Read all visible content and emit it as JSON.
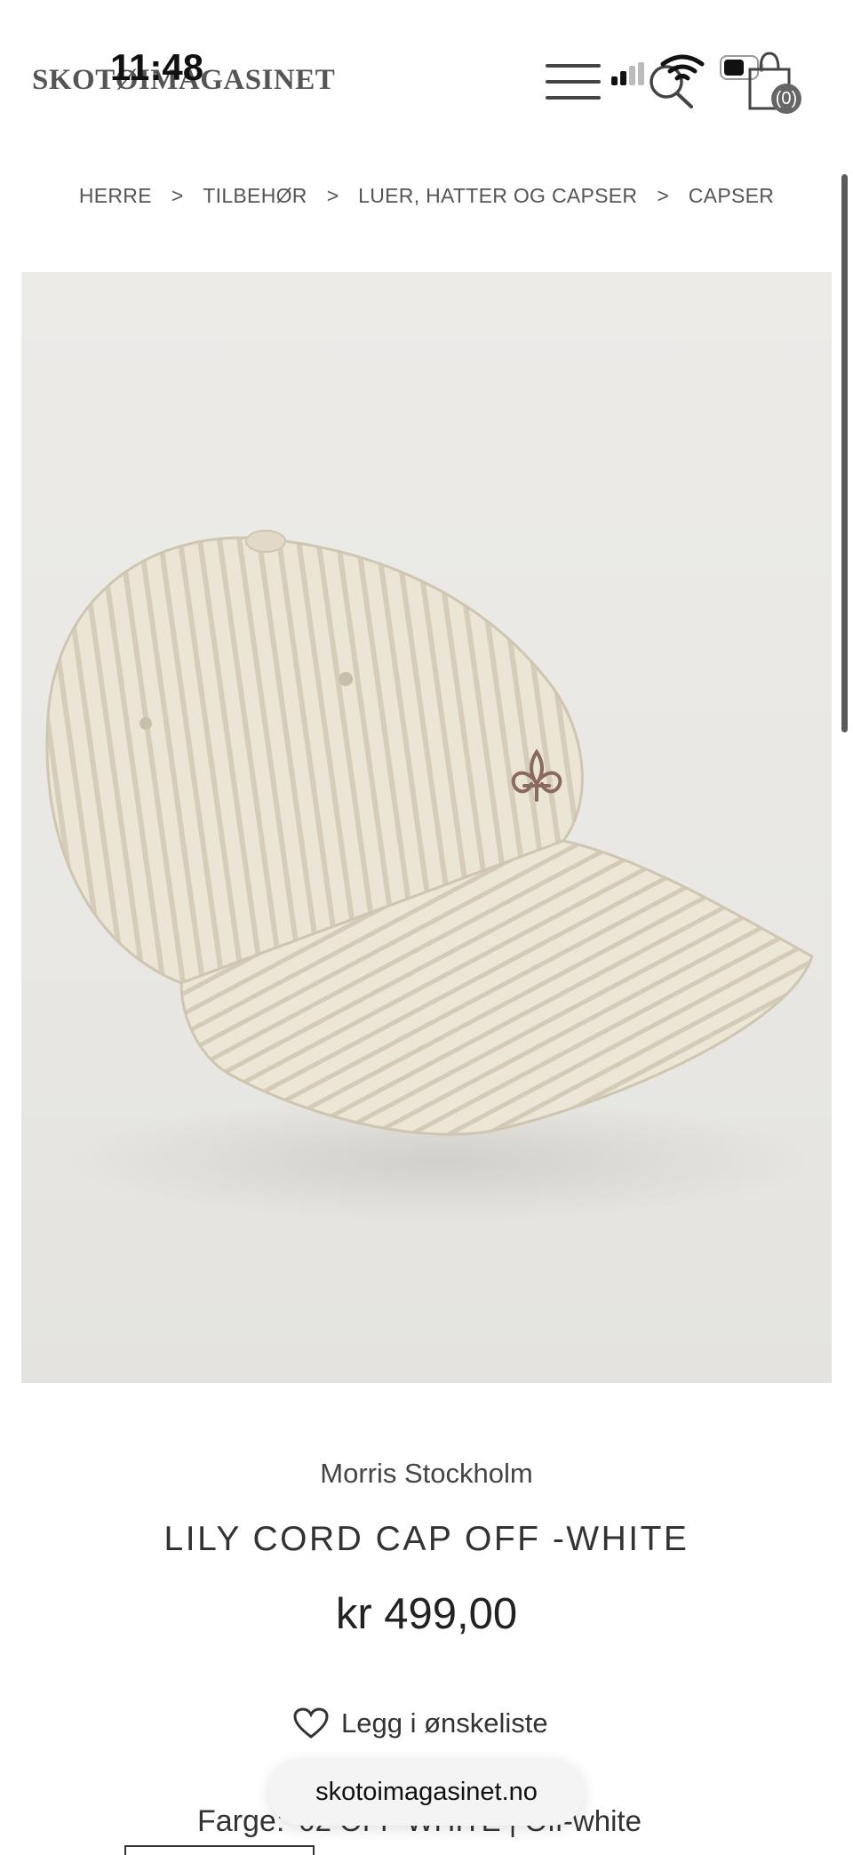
{
  "status_bar": {
    "time": "11:48"
  },
  "header": {
    "logo": "SKOTØIMAGASINET",
    "cart_count": "(0)"
  },
  "breadcrumb": {
    "items": [
      "HERRE",
      "TILBEHØR",
      "LUER, HATTER OG CAPSER",
      "CAPSER"
    ],
    "separator": ">"
  },
  "product": {
    "brand": "Morris Stockholm",
    "title": "LILY CORD CAP OFF -WHITE",
    "price": "kr 499,00",
    "wishlist_label": "Legg i ønskeliste",
    "color_label": "Farge:",
    "color_value": "02 OFF WHITE | Off-white",
    "image_alt": "LILY CORD CAP OFF -WHITE"
  },
  "browser": {
    "url": "skotoimagasinet.no"
  },
  "colors": {
    "text": "#333333",
    "background": "#ffffff",
    "cap": "#e8e2d2",
    "embroidery": "#8a6a5f"
  },
  "icons": [
    "menu-icon",
    "signal-icon",
    "wifi-icon",
    "search-icon",
    "battery-icon",
    "cart-icon",
    "chevron-right-icon",
    "heart-icon"
  ]
}
